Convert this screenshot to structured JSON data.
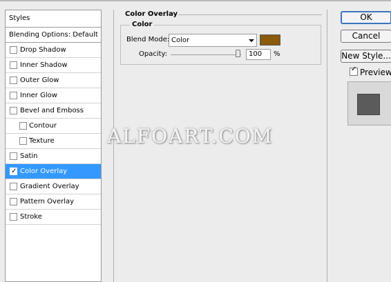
{
  "styles": {
    "header": "Styles",
    "blending": "Blending Options: Default",
    "items": [
      {
        "label": "Drop Shadow",
        "checked": false
      },
      {
        "label": "Inner Shadow",
        "checked": false
      },
      {
        "label": "Outer Glow",
        "checked": false
      },
      {
        "label": "Inner Glow",
        "checked": false
      },
      {
        "label": "Bevel and Emboss",
        "checked": false
      },
      {
        "label": "Contour",
        "checked": false
      },
      {
        "label": "Texture",
        "checked": false
      },
      {
        "label": "Satin",
        "checked": false
      },
      {
        "label": "Color Overlay",
        "checked": true
      },
      {
        "label": "Gradient Overlay",
        "checked": false
      },
      {
        "label": "Pattern Overlay",
        "checked": false
      },
      {
        "label": "Stroke",
        "checked": false
      }
    ]
  },
  "overlay": {
    "section_title": "Color Overlay",
    "group_title": "Color",
    "blend_mode_label": "Blend Mode:",
    "blend_mode_value": "Color",
    "overlay_color": "#8b5a0a",
    "opacity_label": "Opacity:",
    "opacity_value": "100",
    "opacity_unit": "%"
  },
  "buttons": {
    "ok": "OK",
    "cancel": "Cancel",
    "new_style": "New Style...",
    "preview_label": "Preview",
    "preview_checked": true
  },
  "watermark": "ALFOART.COM",
  "check_glyph": "✓"
}
